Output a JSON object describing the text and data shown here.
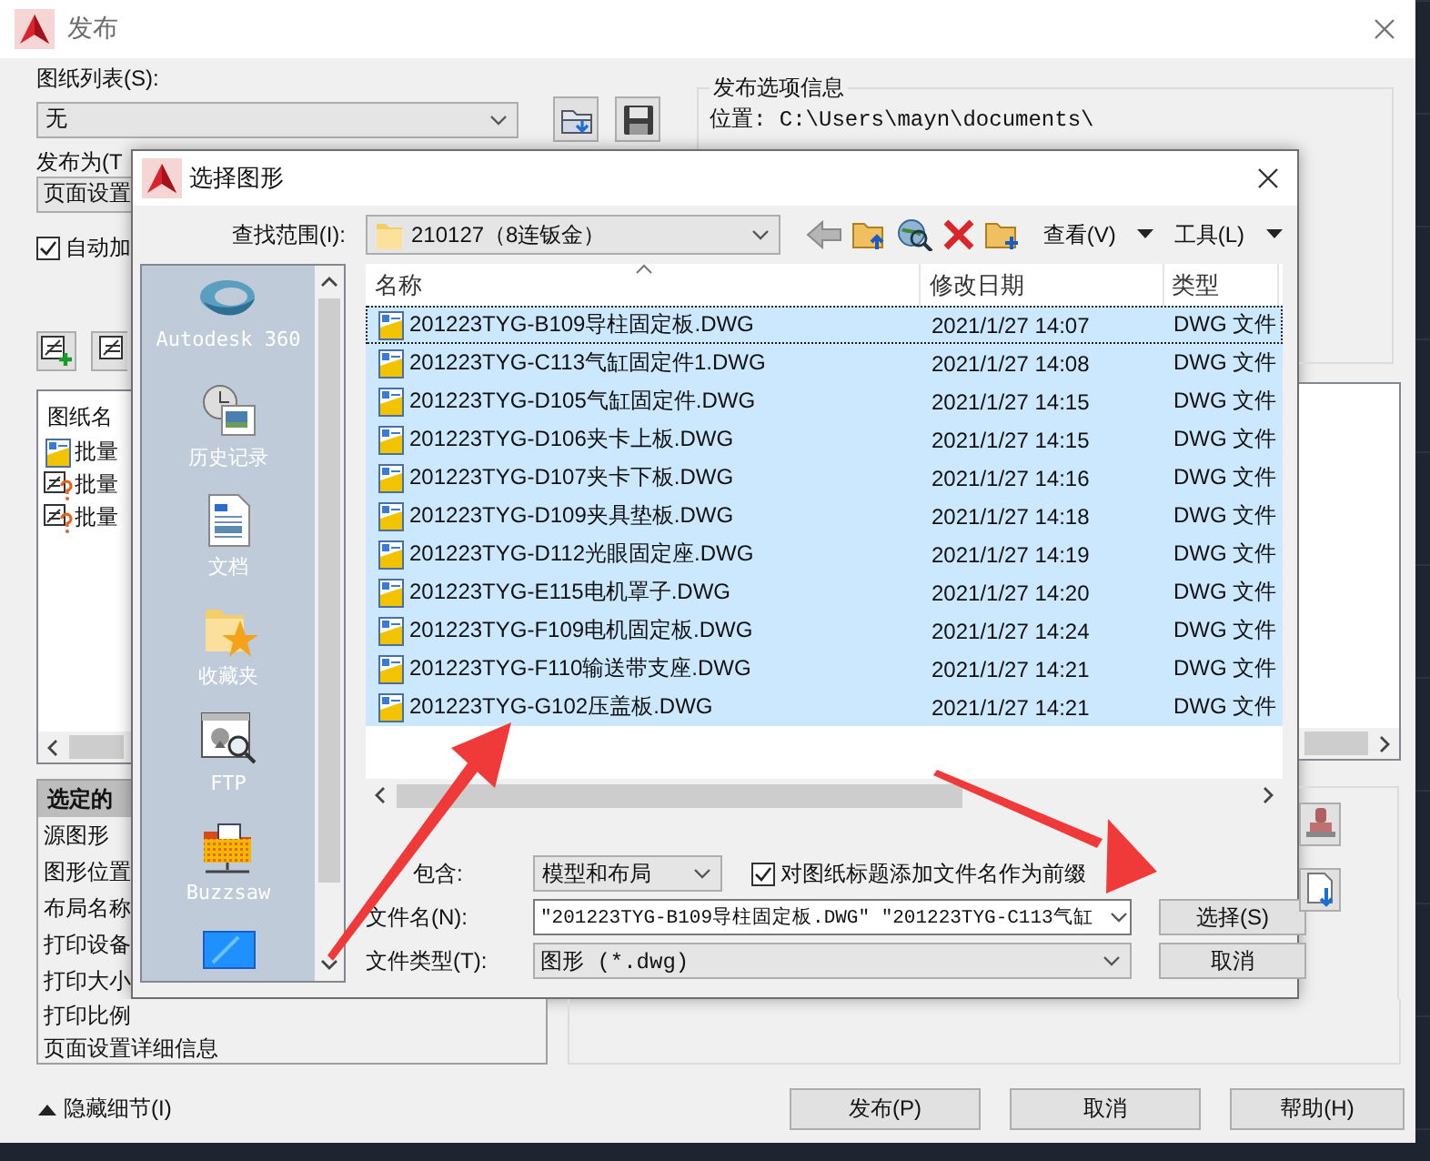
{
  "window": {
    "title": "发布"
  },
  "sheet_list": {
    "label": "图纸列表(S):",
    "value": "无"
  },
  "publish_as": {
    "label": "发布为(T",
    "value": "页面设置"
  },
  "auto_add": {
    "label": "自动加",
    "checked": true
  },
  "sheets": {
    "header": "图纸名",
    "rows": [
      {
        "label": "批量",
        "kind": "dwg"
      },
      {
        "label": "批量",
        "kind": "missing"
      },
      {
        "label": "批量",
        "kind": "missing"
      }
    ]
  },
  "details": {
    "header": "选定的",
    "rows": [
      "源图形",
      "图形位置",
      "布局名称",
      "打印设备",
      "打印大小",
      "打印比例",
      "页面设置详细信息"
    ]
  },
  "options_info": {
    "title": "发布选项信息",
    "location": "位置: C:\\Users\\mayn\\documents\\"
  },
  "hide_details": "隐藏细节(I)",
  "buttons": [
    "发布(P)",
    "取消",
    "帮助(H)"
  ],
  "dialog": {
    "title": "选择图形",
    "look_in": {
      "label": "查找范围(I):",
      "value": "210127（8连钣金）"
    },
    "tools": [
      {
        "label": "查看(V)"
      },
      {
        "label": "工具(L)"
      }
    ],
    "places": [
      {
        "label": "Autodesk 360",
        "kind": "cloud"
      },
      {
        "label": "历史记录",
        "kind": "history"
      },
      {
        "label": "文档",
        "kind": "documents"
      },
      {
        "label": "收藏夹",
        "kind": "favorites"
      },
      {
        "label": "FTP",
        "kind": "ftp"
      },
      {
        "label": "Buzzsaw",
        "kind": "buzzsaw"
      },
      {
        "kind": "desktop"
      }
    ],
    "columns": [
      "名称",
      "修改日期",
      "类型"
    ],
    "files": [
      {
        "name": "201223TYG-B109导柱固定板.DWG",
        "modified": "2021/1/27 14:07",
        "type": "DWG 文件",
        "selected": true,
        "focused": true
      },
      {
        "name": "201223TYG-C113气缸固定件1.DWG",
        "modified": "2021/1/27 14:08",
        "type": "DWG 文件",
        "selected": true,
        "focused": false
      },
      {
        "name": "201223TYG-D105气缸固定件.DWG",
        "modified": "2021/1/27 14:15",
        "type": "DWG 文件",
        "selected": true,
        "focused": false
      },
      {
        "name": "201223TYG-D106夹卡上板.DWG",
        "modified": "2021/1/27 14:15",
        "type": "DWG 文件",
        "selected": true,
        "focused": false
      },
      {
        "name": "201223TYG-D107夹卡下板.DWG",
        "modified": "2021/1/27 14:16",
        "type": "DWG 文件",
        "selected": true,
        "focused": false
      },
      {
        "name": "201223TYG-D109夹具垫板.DWG",
        "modified": "2021/1/27 14:18",
        "type": "DWG 文件",
        "selected": true,
        "focused": false
      },
      {
        "name": "201223TYG-D112光眼固定座.DWG",
        "modified": "2021/1/27 14:19",
        "type": "DWG 文件",
        "selected": true,
        "focused": false
      },
      {
        "name": "201223TYG-E115电机罩子.DWG",
        "modified": "2021/1/27 14:20",
        "type": "DWG 文件",
        "selected": true,
        "focused": false
      },
      {
        "name": "201223TYG-F109电机固定板.DWG",
        "modified": "2021/1/27 14:24",
        "type": "DWG 文件",
        "selected": true,
        "focused": false
      },
      {
        "name": "201223TYG-F110输送带支座.DWG",
        "modified": "2021/1/27 14:21",
        "type": "DWG 文件",
        "selected": true,
        "focused": false
      },
      {
        "name": "201223TYG-G102压盖板.DWG",
        "modified": "2021/1/27 14:21",
        "type": "DWG 文件",
        "selected": true,
        "focused": false
      }
    ],
    "include": {
      "label": "包含:",
      "value": "模型和布局"
    },
    "prefix": {
      "label": "对图纸标题添加文件名作为前缀",
      "checked": true
    },
    "file_name": {
      "label": "文件名(N):",
      "value": "\"201223TYG-B109导柱固定板.DWG\" \"201223TYG-C113气缸"
    },
    "file_type": {
      "label": "文件类型(T):",
      "value": "图形 (*.dwg)"
    },
    "buttons": [
      "选择(S)",
      "取消"
    ]
  }
}
